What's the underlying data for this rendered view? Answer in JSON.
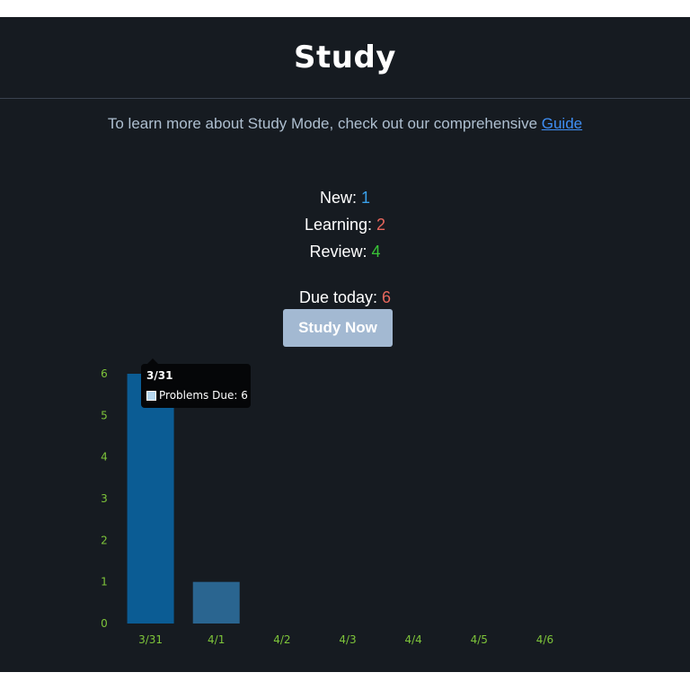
{
  "page": {
    "title": "Study"
  },
  "intro": {
    "text": "To learn more about Study Mode, check out our comprehensive ",
    "link_label": "Guide"
  },
  "stats": {
    "new_label": "New: ",
    "new_value": "1",
    "learning_label": "Learning: ",
    "learning_value": "2",
    "review_label": "Review: ",
    "review_value": "4",
    "due_label": "Due today: ",
    "due_value": "6"
  },
  "actions": {
    "study_now_label": "Study Now"
  },
  "colors": {
    "background": "#161b21",
    "new": "#3aa0ea",
    "learning": "#e8675d",
    "review": "#39c437",
    "button": "#a3b9d2",
    "bar_active": "#0b5c94",
    "bar": "#2a6590",
    "axis_text": "#7ec53a"
  },
  "chart_data": {
    "type": "bar",
    "categories": [
      "3/31",
      "4/1",
      "4/2",
      "4/3",
      "4/4",
      "4/5",
      "4/6"
    ],
    "series": [
      {
        "name": "Problems Due",
        "values": [
          6,
          1,
          0,
          0,
          0,
          0,
          0
        ]
      }
    ],
    "ylim": [
      0,
      6
    ],
    "yticks": [
      "0",
      "1",
      "2",
      "3",
      "4",
      "5",
      "6"
    ],
    "grid": false,
    "tooltip": {
      "title": "3/31",
      "label": "Problems Due: 6"
    }
  }
}
